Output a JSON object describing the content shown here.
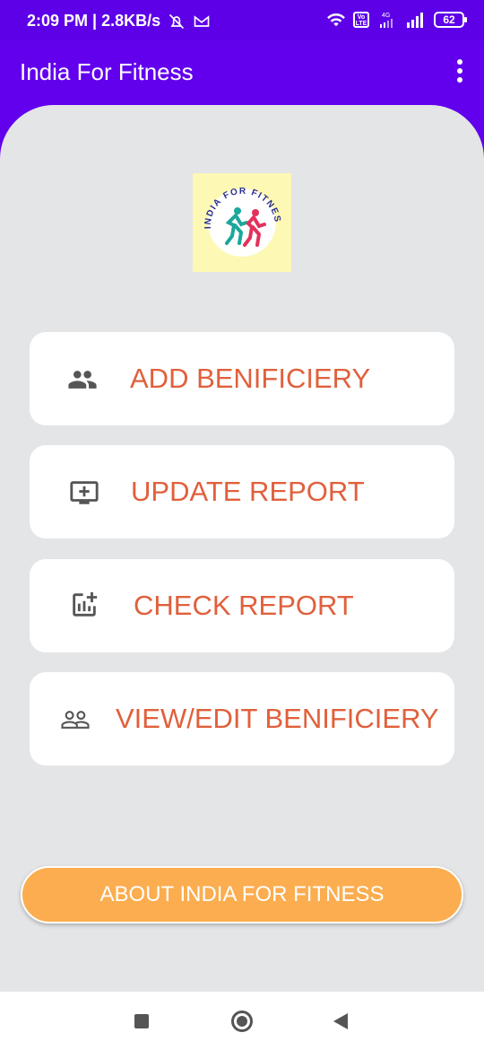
{
  "status_bar": {
    "time_speed": "2:09 PM | 2.8KB/s",
    "network": "4G",
    "volte": "Vo LTE",
    "battery": "62"
  },
  "app_bar": {
    "title": "India For Fitness",
    "overflow_icon": "more-vert-icon"
  },
  "logo": {
    "text": "INDIA FOR FITNESS"
  },
  "menu": [
    {
      "label": "ADD BENIFICIERY",
      "icon": "people-icon"
    },
    {
      "label": "UPDATE REPORT",
      "icon": "add-to-queue-icon"
    },
    {
      "label": "CHECK REPORT",
      "icon": "add-chart-icon"
    },
    {
      "label": "VIEW/EDIT BENIFICIERY",
      "icon": "people-outline-icon"
    }
  ],
  "about_button": {
    "label": "ABOUT INDIA FOR FITNESS"
  },
  "colors": {
    "primary": "#6200ee",
    "accent_text": "#e0603c",
    "about_button": "#fbad4f",
    "background": "#e4e5e7"
  }
}
